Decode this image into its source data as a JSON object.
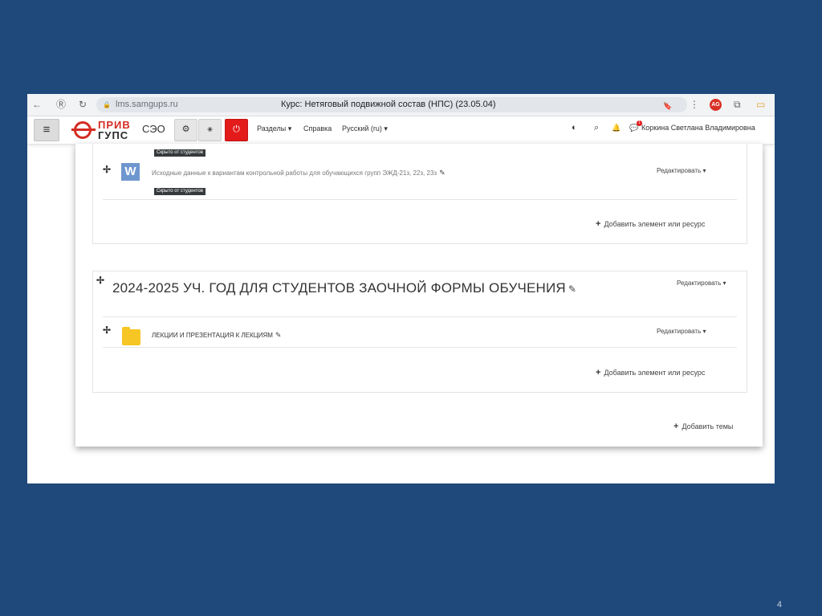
{
  "slide_number": "4",
  "browser": {
    "back_icon": "←",
    "site_icon": "Ⓡ",
    "reload_icon": "↻",
    "lock_icon": "🔒",
    "url": "lms.samgups.ru",
    "page_title": "Курс: Нетяговый подвижной состав (НПС) (23.05.04)",
    "bookmark_icon": "🔖",
    "menu_icon": "⋮",
    "ext_label": "AG",
    "puzzle_icon": "⧉",
    "battery_icon": "▭"
  },
  "navbar": {
    "menu_icon": "≡",
    "logo_line1": "ПРИВ",
    "logo_line2": "ГУПС",
    "seo": "СЭО",
    "btn_gear": "⚙",
    "btn_sitemap": "⚹",
    "btn_power": "⏻",
    "link_sections": "Разделы ▾",
    "link_help": "Справка",
    "link_lang": "Русский (ru) ▾",
    "eye_icon": "◐",
    "search_icon": "⌕",
    "bell_icon": "🔔",
    "chat_icon": "💬",
    "badge_count": "1",
    "user_name": "Коркина Светлана Владимировна"
  },
  "section1": {
    "hidden_badge_top": "Скрыто от студентов",
    "move_icon": "✢",
    "w_icon_label": "W",
    "activity_text": "Исходные данные к вариантам контрольной работы для обучающихся групп ЭЖД-21з, 22з, 23з",
    "pencil": "✎",
    "hidden_badge_bottom": "Скрыто от студентов",
    "edit_label": "Редактировать ▾",
    "add_label": "Добавить элемент или ресурс",
    "add_plus": "+"
  },
  "section2": {
    "move_icon": "✢",
    "title": "2024-2025 УЧ. ГОД ДЛЯ СТУДЕНТОВ ЗАОЧНОЙ ФОРМЫ ОБУЧЕНИЯ",
    "title_pencil": "✎",
    "edit_label": "Редактировать ▾",
    "activity_text": "ЛЕКЦИИ И ПРЕЗЕНТАЦИЯ К ЛЕКЦИЯМ",
    "pencil": "✎",
    "activity_edit_label": "Редактировать ▾",
    "add_label": "Добавить элемент или ресурс",
    "add_plus": "+"
  },
  "footer": {
    "add_topics_plus": "+",
    "add_topics": "Добавить темы"
  }
}
